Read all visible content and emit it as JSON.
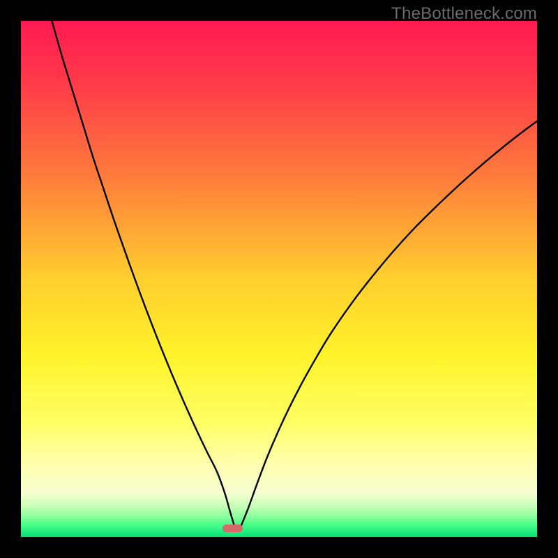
{
  "watermark": {
    "text": "TheBottleneck.com"
  },
  "chart_data": {
    "type": "line",
    "title": "",
    "xlabel": "",
    "ylabel": "",
    "xlim": [
      0,
      100
    ],
    "ylim": [
      0,
      100
    ],
    "grid": false,
    "legend": false,
    "background_gradient_stops": [
      {
        "pct": 0,
        "color": "#ff1a51"
      },
      {
        "pct": 12,
        "color": "#ff3a49"
      },
      {
        "pct": 30,
        "color": "#ff7b3c"
      },
      {
        "pct": 50,
        "color": "#ffcf2e"
      },
      {
        "pct": 65,
        "color": "#fff32a"
      },
      {
        "pct": 78,
        "color": "#ffff66"
      },
      {
        "pct": 86,
        "color": "#ffffb0"
      },
      {
        "pct": 91.5,
        "color": "#f4ffd0"
      },
      {
        "pct": 94,
        "color": "#c8ffb8"
      },
      {
        "pct": 96,
        "color": "#8dff9c"
      },
      {
        "pct": 97.5,
        "color": "#4dff8a"
      },
      {
        "pct": 100,
        "color": "#05e178"
      }
    ],
    "marker": {
      "x": 41,
      "y": 1.7,
      "width_pct": 4.0,
      "height_pct": 1.6,
      "color": "#d46a6a"
    },
    "series": [
      {
        "name": "bottleneck-curve-left",
        "color": "#000000",
        "x": [
          6,
          8,
          10,
          12,
          14,
          16,
          18,
          20,
          22,
          24,
          26,
          28,
          30,
          32,
          34,
          36,
          38,
          39.5,
          40.5,
          41.3
        ],
        "y": [
          100,
          93,
          86.5,
          80,
          73.5,
          67.5,
          61.5,
          55.8,
          50.2,
          44.8,
          39.6,
          34.6,
          29.8,
          25.2,
          20.8,
          16.6,
          12.6,
          8.5,
          5.0,
          2.3
        ]
      },
      {
        "name": "bottleneck-curve-right",
        "color": "#000000",
        "x": [
          42.7,
          44,
          46,
          48,
          51,
          54,
          57,
          60,
          64,
          68,
          72,
          76,
          80,
          84,
          88,
          92,
          96,
          100
        ],
        "y": [
          2.3,
          5.5,
          11.0,
          16.2,
          23.0,
          29.0,
          34.4,
          39.4,
          45.2,
          50.4,
          55.2,
          59.6,
          63.6,
          67.4,
          71.0,
          74.4,
          77.6,
          80.6
        ]
      }
    ]
  }
}
